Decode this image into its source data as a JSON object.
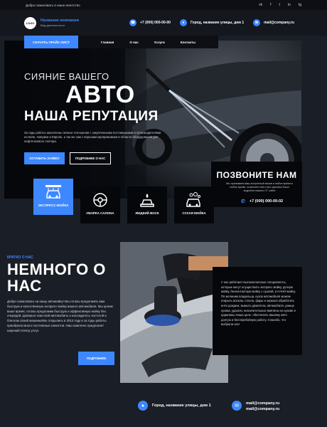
{
  "topbar": {
    "welcome": "Добро пожаловать в наше агентство",
    "social": [
      "vk",
      "f",
      "t",
      "in",
      "tg"
    ]
  },
  "header": {
    "logo": "LOGO",
    "company_name": "Название компании",
    "activity": "Вид деятельности",
    "phone": "+7 (000) 000-00-00",
    "address": "Город, название улицы, дом 1",
    "email": "mail@company.ru"
  },
  "nav": {
    "price_button": "СКАЧАТЬ ПРАЙС-ЛИСТ",
    "items": [
      "Главная",
      "О нас",
      "Услуги",
      "Контакты"
    ]
  },
  "hero": {
    "subtitle": "СИЯНИЕ ВАШЕГО",
    "title_line1": "АВТО",
    "title_line2": "НАША РЕПУТАЦИЯ",
    "description": "За годы работы накоплены личные отношения с закупленными поставщиками и производителями на Кипе, Америки и Европе, а так же сам с ворошим кирприжникам в области оборудования для нефтегазового сектора.",
    "sign_button": "ОСТАВИТЬ ЗАЯВКУ",
    "more_button": "ПОДРОБНЕЕ О НАС"
  },
  "call": {
    "title": "ПОЗВОНИТЕ НАМ",
    "text": "Мы принимаем ваш экстренный вызов в любое время в любое время, позвоните нам и все сделаем Ешол водители нашего СТ сайта",
    "phone": "+7 (000) 000-00-02"
  },
  "services": [
    {
      "label": "ЭКСПРЕСС-МОЙКА",
      "icon": "car-wash-icon"
    },
    {
      "label": "УБОРКА САЛОНА",
      "icon": "steering-wheel-icon"
    },
    {
      "label": "ЖИДКИЙ ВОСК",
      "icon": "wax-icon"
    },
    {
      "label": "СУХАЯ МОЙКА",
      "icon": "dry-wash-icon"
    }
  ],
  "about": {
    "kicker": "КРАТКО О НАС",
    "title": "НЕМНОГО О НАС",
    "description": "Добро пожаловать на нашу автомойку! Мы готовы предложить вам быструю и качественную экспресс-мойку вашего автомобиля. Мы ценим ваше время, готовы предложим быструю и эффективную мойку без очередей. Доверьте нам свой автомобиль и насладитесь чистотой и блеском своей машины!Мы открылись в 2012 году и за годы работы приобрели много постоянных клиентов. Наш комплекс предлагает широкий спектр услуг.",
    "button": "ПОДРОБНЕЕ",
    "panel_text": "У нас работают высококлассные специалисты, которые могут осуществить экспресс мойку, ручную мойку, бесконтактную мойку с сушкой, и НАНО-мойку. По желанию владельца, кузов автомобиля можем покрыть воском, стекла, фары и зеркала обработать анти дождем, вымыть двигатель автомобиля, днище кузова, удалить незначительные вмятины на кузове и царапины.Наша цель- обеспечить вашему авто долгую и бесперебойную работу. Спасибо, что выбрали нас!"
  },
  "footer": {
    "address": "Город, название улицы, дом 1",
    "email1": "mail@company.ru",
    "email2": "mail@company.ru"
  },
  "colors": {
    "accent": "#3e88ff",
    "background": "#1a1e26",
    "panel": "#05070a"
  }
}
